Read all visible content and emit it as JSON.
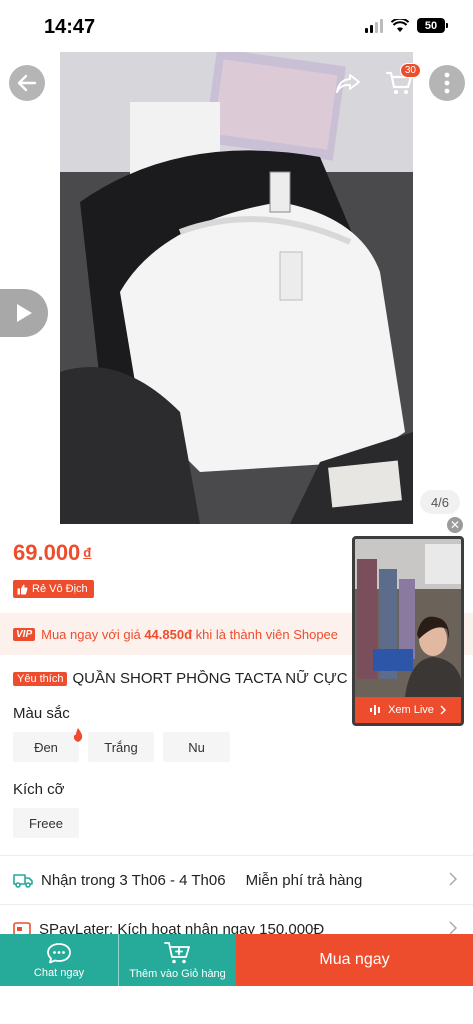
{
  "status_bar": {
    "time": "14:47",
    "battery": "50"
  },
  "header": {
    "back_icon": "arrow-left-icon",
    "share_icon": "share-icon",
    "cart_icon": "cart-icon",
    "cart_badge": "30",
    "more_icon": "more-icon"
  },
  "gallery": {
    "page_indicator": "4/6",
    "play_icon": "play-icon"
  },
  "product": {
    "price": "69.000",
    "currency": "đ",
    "badge": "Rẻ Vô Địch",
    "vip_tag": "VIP",
    "vip_text_before": "Mua ngay với giá ",
    "vip_price": "44.850đ",
    "vip_text_after": " khi là thành viên Shopee",
    "favorite_tag": "Yêu thích",
    "title": "QUẦN SHORT PHỒNG TACTA NỮ CỰC XINH"
  },
  "variations": {
    "color_label": "Màu sắc",
    "colors": [
      "Đen",
      "Trắng",
      "Nu"
    ],
    "size_label": "Kích cỡ",
    "sizes": [
      "Freee"
    ]
  },
  "shipping": {
    "delivery": "Nhận trong 3 Th06 - 4 Th06",
    "returns": "Miễn phí trả hàng"
  },
  "spaylater": {
    "text": "SPayLater: Kích hoạt nhận ngay 150.000Đ"
  },
  "live": {
    "label": "Xem Live"
  },
  "bottom_bar": {
    "chat_label": "Chat ngay",
    "add_cart_label": "Thêm vào Giỏ hàng",
    "buy_label": "Mua ngay"
  },
  "colors": {
    "accent": "#ee4d2d",
    "teal": "#26aa99"
  }
}
